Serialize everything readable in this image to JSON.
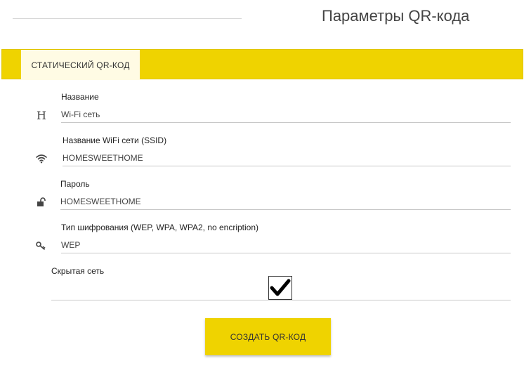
{
  "page": {
    "title": "Параметры QR-кода"
  },
  "tabs": {
    "static_label": "СТАТИЧЕСКИЙ QR-КОД"
  },
  "form": {
    "name": {
      "label": "Название",
      "value": "Wi-Fi сеть",
      "icon": "heading-icon",
      "icon_glyph": "H"
    },
    "ssid": {
      "label": "Название WiFi сети (SSID)",
      "value": "HOMESWEETHOME",
      "icon": "wifi-icon"
    },
    "password": {
      "label": "Пароль",
      "value": "HOMESWEETHOME",
      "icon": "lock-icon"
    },
    "encryption": {
      "label": "Тип шифрования (WEP, WPA, WPA2, no encription)",
      "value": "WEP",
      "icon": "key-icon"
    },
    "hidden": {
      "label": "Скрытая сеть",
      "checked": true
    }
  },
  "actions": {
    "create_label": "СОЗДАТЬ QR-КОД"
  },
  "colors": {
    "accent": "#efd300",
    "tab_active_bg": "#fffbe4",
    "underline": "#c8c8c8"
  }
}
